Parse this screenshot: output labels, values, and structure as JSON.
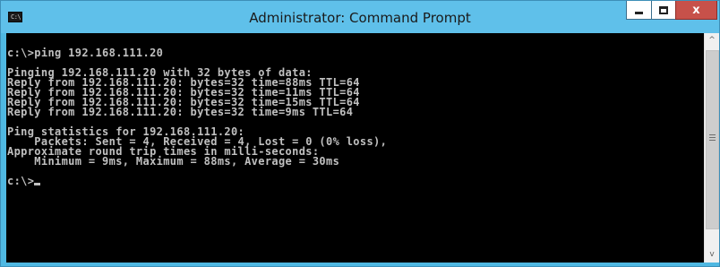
{
  "window": {
    "title": "Administrator: Command Prompt",
    "icon": {
      "name": "cmd-icon",
      "glyph": "C:\\"
    },
    "controls": {
      "minimize": "minimize-icon",
      "maximize": "maximize-icon",
      "close": "close-icon",
      "close_glyph": "x"
    },
    "colors": {
      "titlebar": "#5fc0ea",
      "close": "#c7514a",
      "console_bg": "#000000",
      "console_fg": "#c0c0c0"
    }
  },
  "console": {
    "lines": [
      "",
      "c:\\>ping 192.168.111.20",
      "",
      "Pinging 192.168.111.20 with 32 bytes of data:",
      "Reply from 192.168.111.20: bytes=32 time=88ms TTL=64",
      "Reply from 192.168.111.20: bytes=32 time=11ms TTL=64",
      "Reply from 192.168.111.20: bytes=32 time=15ms TTL=64",
      "Reply from 192.168.111.20: bytes=32 time=9ms TTL=64",
      "",
      "Ping statistics for 192.168.111.20:",
      "    Packets: Sent = 4, Received = 4, Lost = 0 (0% loss),",
      "Approximate round trip times in milli-seconds:",
      "    Minimum = 9ms, Maximum = 88ms, Average = 30ms",
      "",
      "c:\\>"
    ]
  },
  "scrollbar": {
    "up_icon": "scroll-up-icon",
    "down_icon": "scroll-down-icon",
    "up_glyph": "^",
    "down_glyph": "v"
  }
}
